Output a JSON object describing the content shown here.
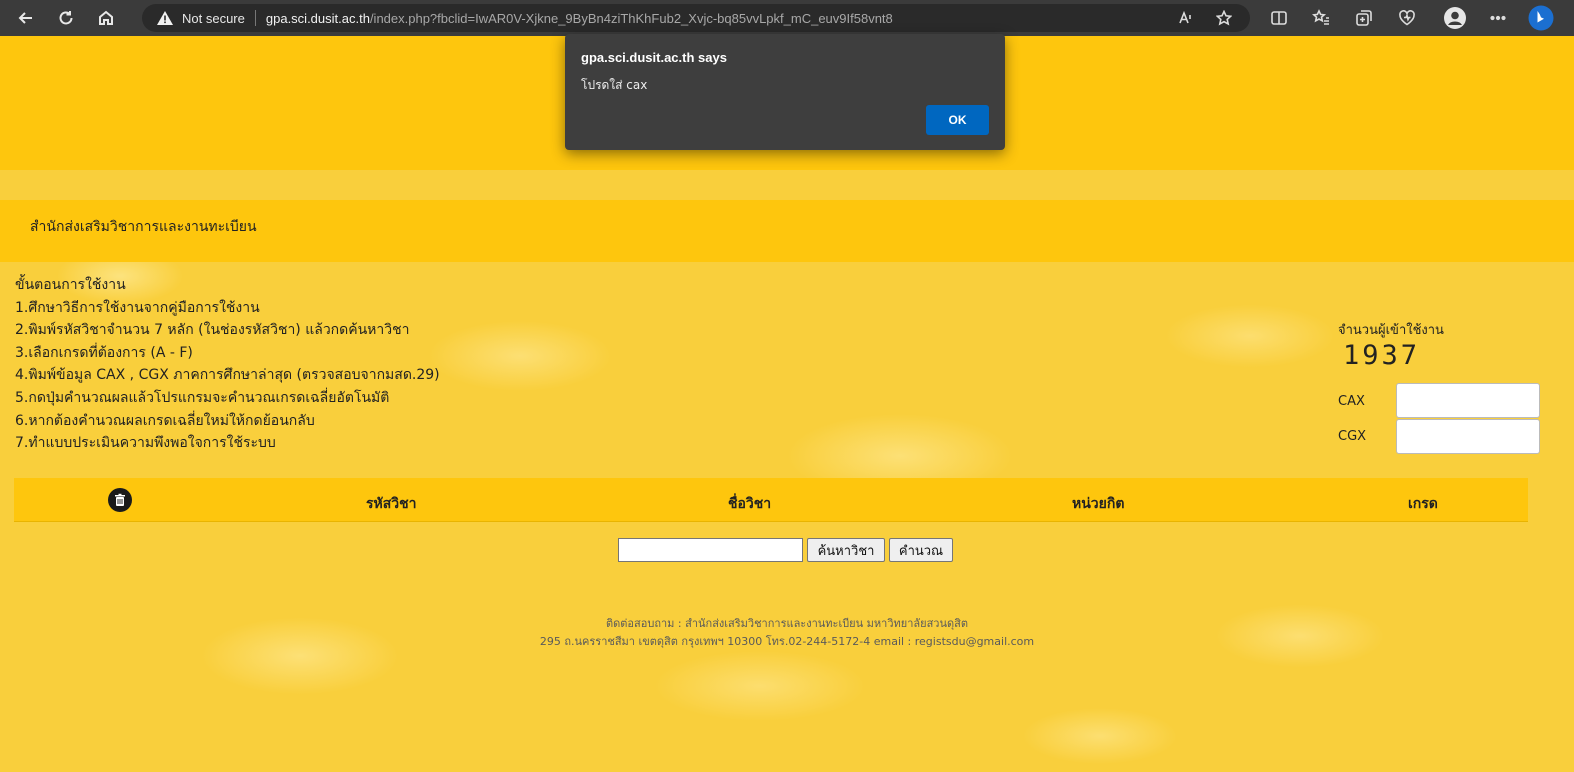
{
  "browser": {
    "security_label": "Not secure",
    "url_host": "gpa.sci.dusit.ac.th",
    "url_path": "/index.php?fbclid=IwAR0V-Xjkne_9ByBn4ziThKhFub2_Xvjc-bq85vvLpkf_mC_euv9If58vnt8"
  },
  "dialog": {
    "title": "gpa.sci.dusit.ac.th says",
    "message": "โปรดใส่ cax",
    "ok_label": "OK"
  },
  "header": {
    "office_name": "สำนักส่งเสริมวิชาการและงานทะเบียน"
  },
  "instructions": {
    "heading": "ขั้นตอนการใช้งาน",
    "steps": [
      "1.ศึกษาวิธีการใช้งานจากคู่มือการใช้งาน",
      "2.พิมพ์รหัสวิชาจำนวน 7 หลัก (ในช่องรหัสวิชา) แล้วกดค้นหาวิชา",
      "3.เลือกเกรดที่ต้องการ (A - F)",
      "4.พิมพ์ข้อมูล CAX , CGX ภาคการศึกษาล่าสุด (ตรวจสอบจากมสด.29)",
      "5.กดปุ่มคำนวณผลแล้วโปรแกรมจะคำนวณเกรดเฉลี่ยอัตโนมัติ",
      "6.หากต้องคำนวณผลเกรดเฉลี่ยใหม่ให้กดย้อนกลับ",
      "7.ทำแบบประเมินความพึงพอใจการใช้ระบบ"
    ]
  },
  "stats": {
    "visitor_label": "จำนวนผู้เข้าใช้งาน",
    "visitor_count": "1937",
    "cax_label": "CAX",
    "cgx_label": "CGX"
  },
  "table": {
    "headers": [
      "รหัสวิชา",
      "ชื่อวิชา",
      "หน่วยกิต",
      "เกรด"
    ]
  },
  "actions": {
    "search_label": "ค้นหาวิชา",
    "calc_label": "คำนวณ"
  },
  "footer": {
    "line1": "ติดต่อสอบถาม : สำนักส่งเสริมวิชาการและงานทะเบียน มหาวิทยาลัยสวนดุสิต",
    "line2": "295 ถ.นครราชสีมา เขตดุสิต กรุงเทพฯ 10300 โทร.02-244-5172-4 email : registsdu@gmail.com"
  },
  "colors": {
    "accent_yellow": "#fec60d",
    "page_yellow": "#f9cf3c",
    "dialog_button": "#0067c0"
  }
}
